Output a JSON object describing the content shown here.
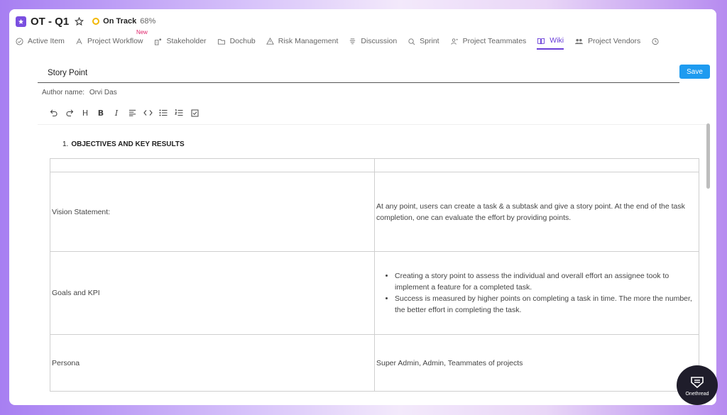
{
  "project": {
    "title": "OT - Q1",
    "status": "On Track",
    "progress": "68%",
    "status_color": "#f2b705",
    "badge_color": "#7a4fe0"
  },
  "tabs": [
    {
      "label": "Active Item",
      "icon": "check-circle-icon"
    },
    {
      "label": "Project Workflow",
      "icon": "workflow-icon",
      "badge": "New"
    },
    {
      "label": "Stakeholder",
      "icon": "stakeholder-icon"
    },
    {
      "label": "Dochub",
      "icon": "folder-icon"
    },
    {
      "label": "Risk Management",
      "icon": "risk-icon"
    },
    {
      "label": "Discussion",
      "icon": "discussion-icon"
    },
    {
      "label": "Sprint",
      "icon": "sprint-icon"
    },
    {
      "label": "Project Teammates",
      "icon": "teammates-icon"
    },
    {
      "label": "Wiki",
      "icon": "book-icon",
      "active": true
    },
    {
      "label": "Project Vendors",
      "icon": "vendors-icon"
    }
  ],
  "editor": {
    "title_value": "Story Point",
    "save_label": "Save",
    "author_label": "Author name:",
    "author_name": "Orvi Das"
  },
  "toolbar": [
    "undo-icon",
    "redo-icon",
    "heading-icon",
    "bold-icon",
    "italic-icon",
    "align-icon",
    "code-icon",
    "bullet-list-icon",
    "numbered-list-icon",
    "checklist-icon"
  ],
  "document": {
    "heading_number": "1.",
    "heading": "OBJECTIVES AND KEY RESULTS",
    "rows": [
      {
        "label": "Vision Statement:",
        "text": "At any point, users can create a task & a subtask and give a story point. At the end of the task completion, one can evaluate the effort by providing points."
      },
      {
        "label": "Goals and KPI",
        "bullets": [
          "Creating a story point to assess the individual and overall effort an assignee took to implement a feature for a completed task.",
          "Success is measured by higher points on completing a task in time. The more the number, the better effort in completing the task."
        ]
      },
      {
        "label": "Persona",
        "text": "Super Admin, Admin, Teammates of projects"
      }
    ]
  },
  "brand": {
    "name": "Onethread"
  },
  "accent": "#6a3ed8",
  "save_color": "#1e9bf0"
}
